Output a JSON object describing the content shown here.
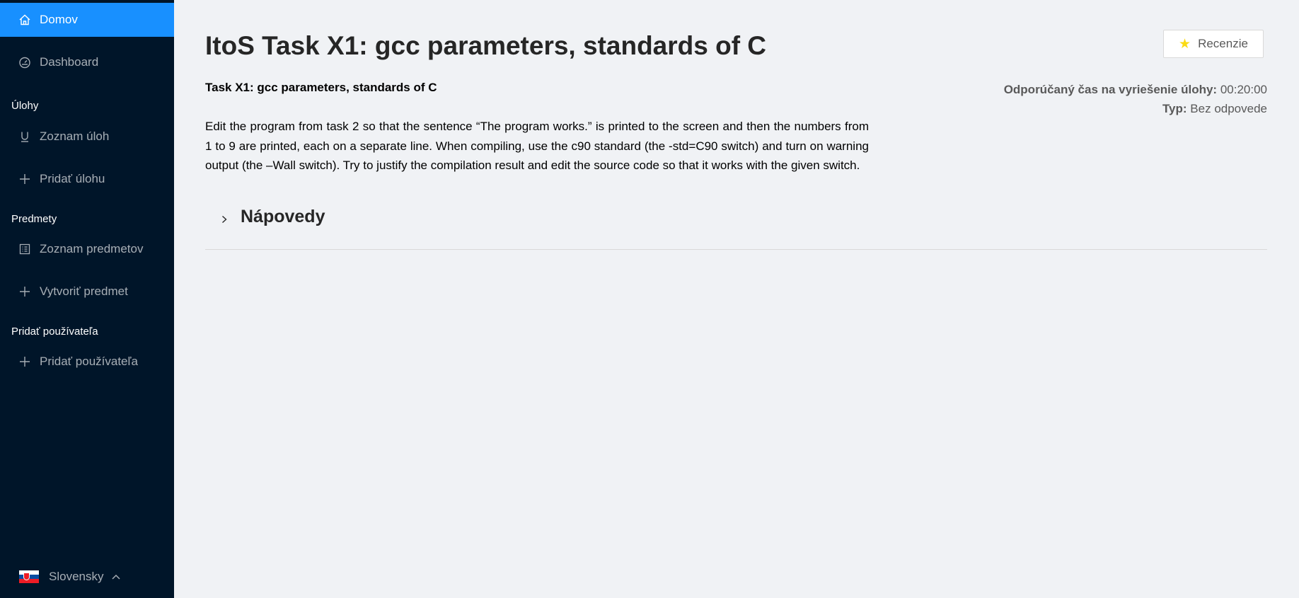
{
  "sidebar": {
    "items": [
      {
        "label": "Domov",
        "icon": "home-icon"
      },
      {
        "label": "Dashboard",
        "icon": "dashboard-icon"
      },
      {
        "label": "Zoznam úloh",
        "icon": "underline-icon"
      },
      {
        "label": "Pridať úlohu",
        "icon": "plus-icon"
      },
      {
        "label": "Zoznam predmetov",
        "icon": "list-icon"
      },
      {
        "label": "Vytvoriť predmet",
        "icon": "plus-icon"
      },
      {
        "label": "Pridať používateľa",
        "icon": "plus-icon"
      }
    ],
    "groups": [
      "Úlohy",
      "Predmety",
      "Pridať používateľa"
    ],
    "language": "Slovensky"
  },
  "main": {
    "title": "ItoS Task X1: gcc parameters, standards of C",
    "review_label": "Recenzie",
    "subtitle": "Task X1: gcc parameters, standards of C",
    "time_label": "Odporúčaný čas na vyriešenie úlohy:",
    "time_value": "00:20:00",
    "type_label": "Typ:",
    "type_value": "Bez odpovede",
    "description": "Edit the program from task 2 so that the sentence “The program works.” is printed to the screen and then the numbers from 1 to 9 are printed, each on a separate line. When compiling, use the c90 standard (the -std=C90 switch) and turn on warning output (the –Wall switch). Try to justify the compilation result and edit the source code so that it works with the given switch.",
    "hints_label": "Nápovedy"
  },
  "colors": {
    "sidebar_bg": "#001529",
    "accent": "#1890ff",
    "page_bg": "#f0f2f5",
    "star": "#fadb14"
  }
}
